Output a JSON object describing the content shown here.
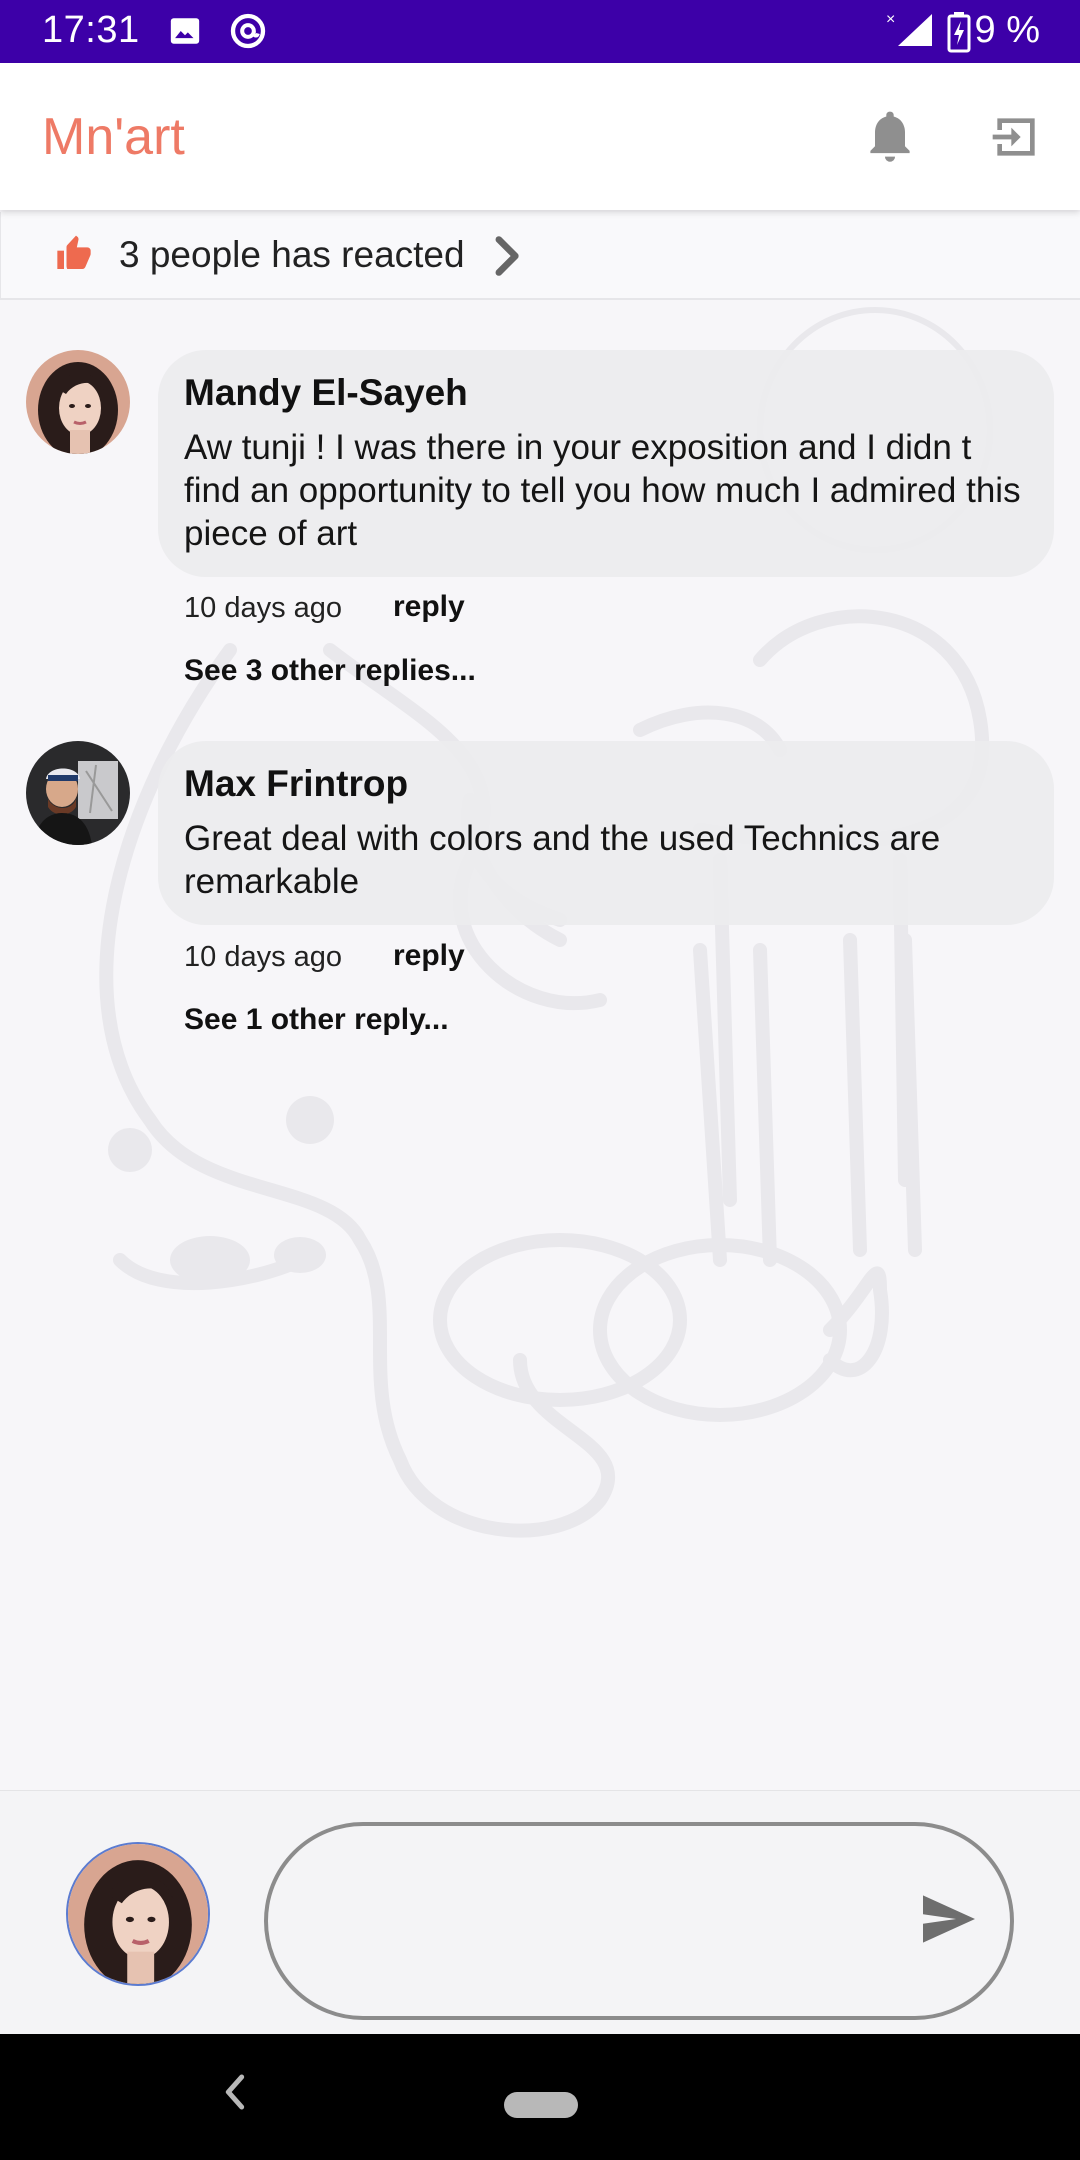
{
  "status_bar": {
    "time": "17:31",
    "battery": "9 %",
    "icons": [
      "image-icon",
      "at-sign-icon",
      "signal-icon",
      "battery-charging-icon"
    ],
    "background": "#3d00a8"
  },
  "app_bar": {
    "title": "Mn'art",
    "title_color": "#ee7a66",
    "icons": [
      "bell-icon",
      "exit-icon"
    ]
  },
  "reactions": {
    "label": "3 people has reacted",
    "icon": "thumb-up-icon",
    "icon_color": "#ee6a4f"
  },
  "comments": [
    {
      "author": "Mandy El-Sayeh",
      "text": "Aw tunji ! I was there in your exposition and I didn t find an opportunity to tell you how much I admired this piece of art",
      "time": "10 days ago",
      "reply_label": "reply",
      "see_replies": "See 3 other replies..."
    },
    {
      "author": "Max Frintrop",
      "text": "Great deal with colors and the used Technics are remarkable",
      "time": "10 days ago",
      "reply_label": "reply",
      "see_replies": "See 1 other reply..."
    }
  ],
  "composer": {
    "value": "",
    "icons": [
      "avatar",
      "send-icon"
    ]
  },
  "nav_bar": {
    "icons": [
      "back-icon",
      "home-pill"
    ]
  }
}
